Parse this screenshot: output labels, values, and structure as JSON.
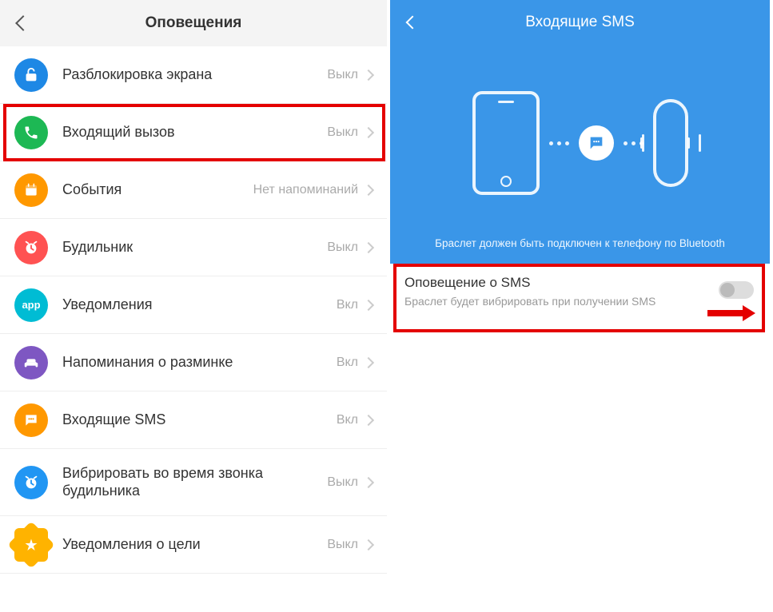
{
  "left": {
    "title": "Оповещения",
    "items": [
      {
        "key": "unlock",
        "label": "Разблокировка экрана",
        "status": "Выкл"
      },
      {
        "key": "incoming-call",
        "label": "Входящий вызов",
        "status": "Выкл"
      },
      {
        "key": "events",
        "label": "События",
        "status": "Нет напоминаний"
      },
      {
        "key": "alarm",
        "label": "Будильник",
        "status": "Выкл"
      },
      {
        "key": "notifications",
        "label": "Уведомления",
        "status": "Вкл"
      },
      {
        "key": "activity",
        "label": "Напоминания о разминке",
        "status": "Вкл"
      },
      {
        "key": "sms",
        "label": "Входящие SMS",
        "status": "Вкл"
      },
      {
        "key": "alarm-vibrate",
        "label": "Вибрировать во время звонка будильника",
        "status": "Выкл"
      },
      {
        "key": "goal",
        "label": "Уведомления о цели",
        "status": "Выкл"
      }
    ]
  },
  "right": {
    "title": "Входящие SMS",
    "hero_caption": "Браслет должен быть подключен к телефону по Bluetooth",
    "setting_title": "Оповещение о SMS",
    "setting_desc": "Браслет будет вибрировать при получении SMS"
  }
}
